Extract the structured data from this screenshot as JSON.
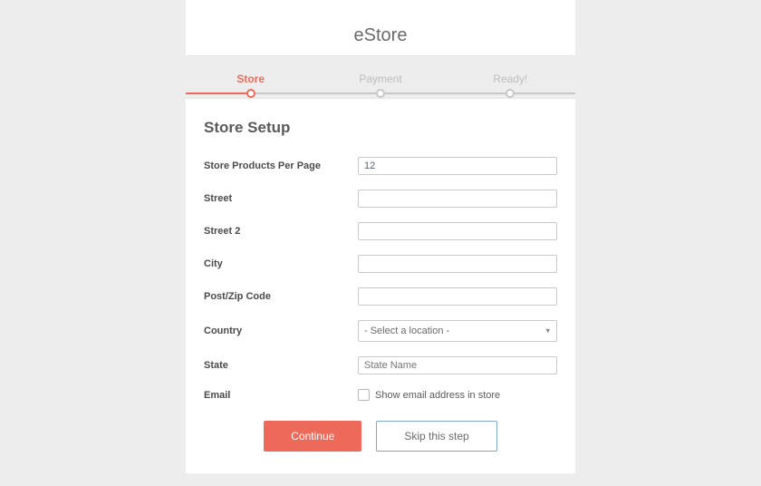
{
  "header": {
    "title": "eStore"
  },
  "steps": {
    "items": [
      {
        "label": "Store",
        "active": true
      },
      {
        "label": "Payment",
        "active": false
      },
      {
        "label": "Ready!",
        "active": false
      }
    ]
  },
  "page": {
    "title": "Store Setup"
  },
  "form": {
    "products_per_page": {
      "label": "Store Products Per Page",
      "value": "12"
    },
    "street": {
      "label": "Street",
      "value": ""
    },
    "street2": {
      "label": "Street 2",
      "value": ""
    },
    "city": {
      "label": "City",
      "value": ""
    },
    "postcode": {
      "label": "Post/Zip Code",
      "value": ""
    },
    "country": {
      "label": "Country",
      "placeholder": "- Select a location -"
    },
    "state": {
      "label": "State",
      "placeholder": "State Name",
      "value": ""
    },
    "email": {
      "label": "Email",
      "checkbox_label": "Show email address in store"
    }
  },
  "actions": {
    "continue": "Continue",
    "skip": "Skip this step"
  }
}
